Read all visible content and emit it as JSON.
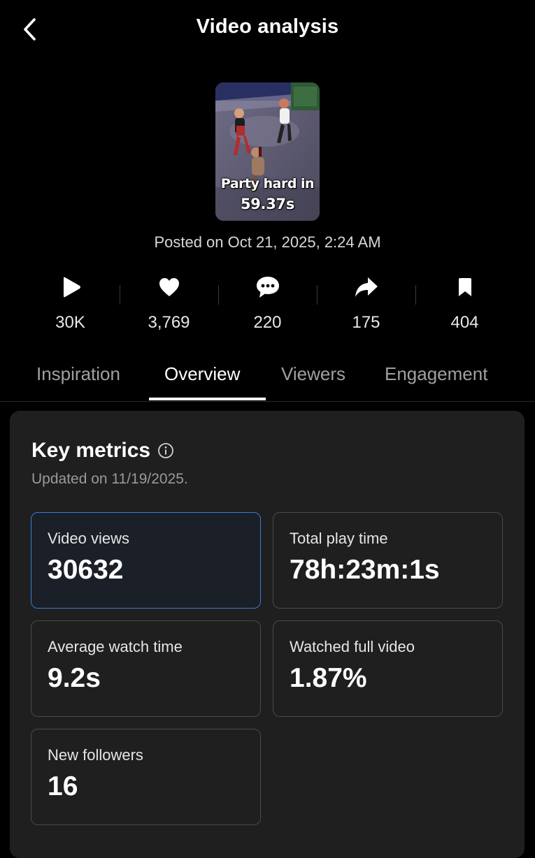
{
  "header": {
    "title": "Video analysis"
  },
  "video": {
    "caption_line1": "Party hard in",
    "caption_line2": "59.37s",
    "posted": "Posted on Oct 21, 2025, 2:24 AM"
  },
  "stats": [
    {
      "icon": "play-icon",
      "value": "30K"
    },
    {
      "icon": "heart-icon",
      "value": "3,769"
    },
    {
      "icon": "comment-icon",
      "value": "220"
    },
    {
      "icon": "share-icon",
      "value": "175"
    },
    {
      "icon": "bookmark-icon",
      "value": "404"
    }
  ],
  "tabs": [
    {
      "label": "Inspiration",
      "active": false
    },
    {
      "label": "Overview",
      "active": true
    },
    {
      "label": "Viewers",
      "active": false
    },
    {
      "label": "Engagement",
      "active": false
    }
  ],
  "key_metrics": {
    "title": "Key metrics",
    "updated": "Updated on 11/19/2025.",
    "items": [
      {
        "label": "Video views",
        "value": "30632",
        "selected": true
      },
      {
        "label": "Total play time",
        "value": "78h:23m:1s",
        "selected": false
      },
      {
        "label": "Average watch time",
        "value": "9.2s",
        "selected": false
      },
      {
        "label": "Watched full video",
        "value": "1.87%",
        "selected": false
      },
      {
        "label": "New followers",
        "value": "16",
        "selected": false
      }
    ]
  },
  "colors": {
    "background": "#000000",
    "card": "#1f1f1f",
    "selected_border": "#3a7bd5",
    "muted_text": "#9a9a9a"
  }
}
